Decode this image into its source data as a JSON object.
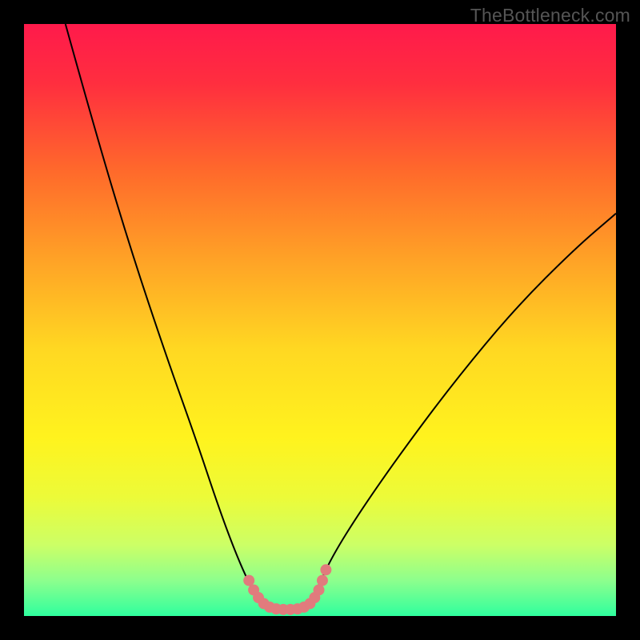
{
  "watermark": "TheBottleneck.com",
  "accent_colors": {
    "marker": "#e17b7d",
    "curve": "#000000"
  },
  "chart_data": {
    "type": "line",
    "title": "",
    "xlabel": "",
    "ylabel": "",
    "xlim": [
      0,
      100
    ],
    "ylim": [
      0,
      100
    ],
    "grid": false,
    "legend": false,
    "background_gradient_stops": [
      {
        "offset": 0.0,
        "color": "#ff1a4b"
      },
      {
        "offset": 0.1,
        "color": "#ff2e3f"
      },
      {
        "offset": 0.25,
        "color": "#ff6a2b"
      },
      {
        "offset": 0.4,
        "color": "#ffa326"
      },
      {
        "offset": 0.55,
        "color": "#ffd822"
      },
      {
        "offset": 0.7,
        "color": "#fff31e"
      },
      {
        "offset": 0.8,
        "color": "#ecfb39"
      },
      {
        "offset": 0.88,
        "color": "#ccff66"
      },
      {
        "offset": 0.94,
        "color": "#8dff8d"
      },
      {
        "offset": 1.0,
        "color": "#2fff9e"
      }
    ],
    "series": [
      {
        "name": "bottleneck-curve",
        "stroke": "#000000",
        "points": [
          {
            "x": 7,
            "y": 100
          },
          {
            "x": 12,
            "y": 82
          },
          {
            "x": 18,
            "y": 62
          },
          {
            "x": 24,
            "y": 44
          },
          {
            "x": 29,
            "y": 30
          },
          {
            "x": 33,
            "y": 18
          },
          {
            "x": 36,
            "y": 10
          },
          {
            "x": 38.5,
            "y": 4.5
          },
          {
            "x": 40,
            "y": 2
          },
          {
            "x": 42,
            "y": 1
          },
          {
            "x": 46,
            "y": 1
          },
          {
            "x": 48,
            "y": 2
          },
          {
            "x": 49.5,
            "y": 4.5
          },
          {
            "x": 52,
            "y": 10
          },
          {
            "x": 57,
            "y": 18
          },
          {
            "x": 64,
            "y": 28
          },
          {
            "x": 73,
            "y": 40
          },
          {
            "x": 83,
            "y": 52
          },
          {
            "x": 93,
            "y": 62
          },
          {
            "x": 100,
            "y": 68
          }
        ]
      }
    ],
    "markers": {
      "name": "optimal-region",
      "color": "#e17b7d",
      "radius_px": 7,
      "points": [
        {
          "x": 38.0,
          "y": 6.0
        },
        {
          "x": 38.8,
          "y": 4.4
        },
        {
          "x": 39.6,
          "y": 3.1
        },
        {
          "x": 40.5,
          "y": 2.1
        },
        {
          "x": 41.5,
          "y": 1.5
        },
        {
          "x": 42.6,
          "y": 1.2
        },
        {
          "x": 43.8,
          "y": 1.1
        },
        {
          "x": 45.0,
          "y": 1.1
        },
        {
          "x": 46.2,
          "y": 1.2
        },
        {
          "x": 47.3,
          "y": 1.5
        },
        {
          "x": 48.3,
          "y": 2.1
        },
        {
          "x": 49.1,
          "y": 3.1
        },
        {
          "x": 49.8,
          "y": 4.4
        },
        {
          "x": 50.4,
          "y": 6.0
        },
        {
          "x": 51.0,
          "y": 7.8
        }
      ]
    }
  }
}
